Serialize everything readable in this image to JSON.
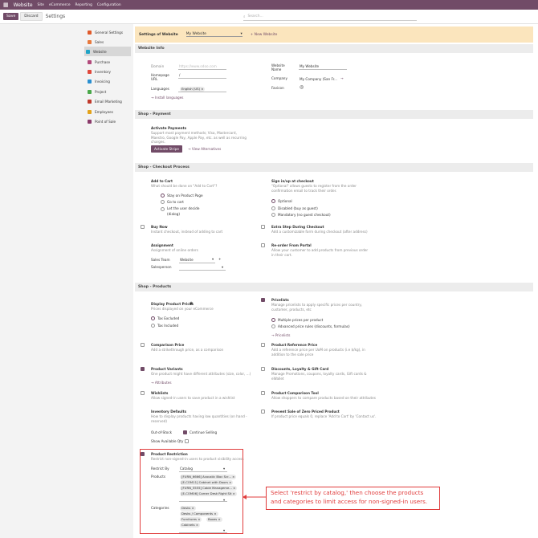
{
  "topbar": {
    "app": "Website",
    "menu": [
      "Site",
      "eCommerce",
      "Reporting",
      "Configuration"
    ]
  },
  "control": {
    "save": "Save",
    "discard": "Discard",
    "title": "Settings",
    "search_placeholder": "Search..."
  },
  "sidebar": {
    "items": [
      {
        "label": "General Settings",
        "icon": "gear-icon",
        "color": "#e05a2a"
      },
      {
        "label": "Sales",
        "icon": "sales-icon",
        "color": "#e8793d"
      },
      {
        "label": "Website",
        "icon": "website-icon",
        "color": "#1fa3c6"
      },
      {
        "label": "Purchase",
        "icon": "purchase-icon",
        "color": "#b24a7b"
      },
      {
        "label": "Inventory",
        "icon": "inventory-icon",
        "color": "#e0483c"
      },
      {
        "label": "Invoicing",
        "icon": "invoicing-icon",
        "color": "#2a8fd0"
      },
      {
        "label": "Project",
        "icon": "project-icon",
        "color": "#4aa84a"
      },
      {
        "label": "Email Marketing",
        "icon": "email-marketing-icon",
        "color": "#c0392b"
      },
      {
        "label": "Employees",
        "icon": "employees-icon",
        "color": "#e3a21a"
      },
      {
        "label": "Point of Sale",
        "icon": "point-of-sale-icon",
        "color": "#8a3a6a"
      }
    ]
  },
  "settings_of_website": {
    "label": "Settings of Website",
    "value": "My Website",
    "new": "+ New Website"
  },
  "website_info": {
    "title": "Website Info",
    "domain_label": "Domain",
    "domain_placeholder": "https://www.odoo.com",
    "homepage_label": "Homepage URL",
    "homepage_value": "/",
    "languages_label": "Languages",
    "language_pill": "English (US) ×",
    "install_languages": "→ Install languages",
    "website_name_label": "Website Name",
    "website_name_value": "My Website",
    "company_label": "Company",
    "company_value": "My Company (San Fr...",
    "favicon_label": "Favicon"
  },
  "shop_payment": {
    "title": "Shop - Payment",
    "activate_label": "Activate Payments",
    "activate_desc": "Support most payment methods; Visa, Mastercard, Maestro, Google Pay, Apple Pay, etc. as well as recurring charges.",
    "activate_stripe": "Activate Stripe",
    "view_alternatives": "→ View Alternatives"
  },
  "checkout": {
    "title": "Shop - Checkout Process",
    "add_to_cart_label": "Add to Cart",
    "add_to_cart_desc": "What should be done on \"Add to Cart\"?",
    "add_to_cart_options": [
      "Stay on Product Page",
      "Go to cart",
      "Let the user decide",
      "(dialog)"
    ],
    "signin_label": "Sign in/up at checkout",
    "signin_desc": "\"Optional\" allows guests to register from the order confirmation email to track their order.",
    "signin_options": [
      "Optional",
      "Disabled (buy as guest)",
      "Mandatory (no guest checkout)"
    ],
    "buy_now_label": "Buy Now",
    "buy_now_desc": "Instant checkout, instead of adding to cart",
    "extra_step_label": "Extra Step During Checkout",
    "extra_step_desc": "Add a customizable form during checkout (after address)",
    "assignment_label": "Assignment",
    "assignment_desc": "Assignment of online orders",
    "sales_team_label": "Sales Team",
    "sales_team_value": "Website",
    "salesperson_label": "Salesperson",
    "reorder_label": "Re-order From Portal",
    "reorder_desc": "Allow your customer to add products from previous order in their cart."
  },
  "products": {
    "title": "Shop - Products",
    "pricelists_label": "Pricelists",
    "pricelists_desc": "Manage pricelists to apply specific prices per country, customer, products, etc",
    "pricelist_options": [
      "Multiple prices per product",
      "Advanced price rules (discounts, formulas)"
    ],
    "pricelists_link": "→ Pricelists",
    "display_prices_label": "Display Product Prices",
    "display_prices_desc": "Prices displayed on your eCommerce",
    "tax_options": [
      "Tax Excluded",
      "Tax Included"
    ],
    "comparison_label": "Comparison Price",
    "comparison_desc": "Add a strikethrough price, as a comparison",
    "reference_label": "Product Reference Price",
    "reference_desc": "Add a reference price per UoM on products (i.e $/kg), in addition to the sale price",
    "variants_label": "Product Variants",
    "variants_desc": "One product might have different attributes (size, color, ...)",
    "attributes_link": "→ Attributes",
    "discounts_label": "Discounts, Loyalty & Gift Card",
    "discounts_desc": "Manage Promotions, coupons, loyalty cards, Gift cards & eWallet",
    "wishlists_label": "Wishlists",
    "wishlists_desc": "Allow signed-in users to save product in a wishlist",
    "comparison_tool_label": "Product Comparison Tool",
    "comparison_tool_desc": "Allow shoppers to compare products based on their attributes",
    "inventory_label": "Inventory Defaults",
    "inventory_desc": "How to display products having low quantities (on hand - reserved)",
    "out_of_stock_label": "Out-of-Stock",
    "continue_selling": "Continue Selling",
    "show_qty_label": "Show Available Qty",
    "zero_price_label": "Prevent Sale of Zero Priced Product",
    "zero_price_desc": "If product price equals 0, replace 'Add to Cart' by 'Contact us'.",
    "restriction_label": "Product Restriction",
    "restriction_desc": "Restrict non-signed-in users to product visibility access",
    "restrict_by_label": "Restrict By",
    "restrict_by_value": "Catalog",
    "products_label": "Products",
    "product_pills": [
      "[FURN_6666] Acoustic Bloc Scr... ×",
      "[E-COM11] Cabinet with Doors ×",
      "[FURN_5555] Cable Manageme... ×",
      "[E-COM06] Corner Desk Right Sit ×"
    ],
    "categories_label": "Categories",
    "category_pills": [
      "Desks ×",
      "Desks / Components ×",
      "Furnitures ×",
      "Boxes ×",
      "Cabinets ×"
    ]
  },
  "callout": {
    "text": "Select 'restrict by catalog,' then choose the products and categories to limit access for non-signed-in users."
  },
  "colors": {
    "brand": "#714b67",
    "highlight": "#fbe5bd",
    "callout": "#e03c3c"
  }
}
